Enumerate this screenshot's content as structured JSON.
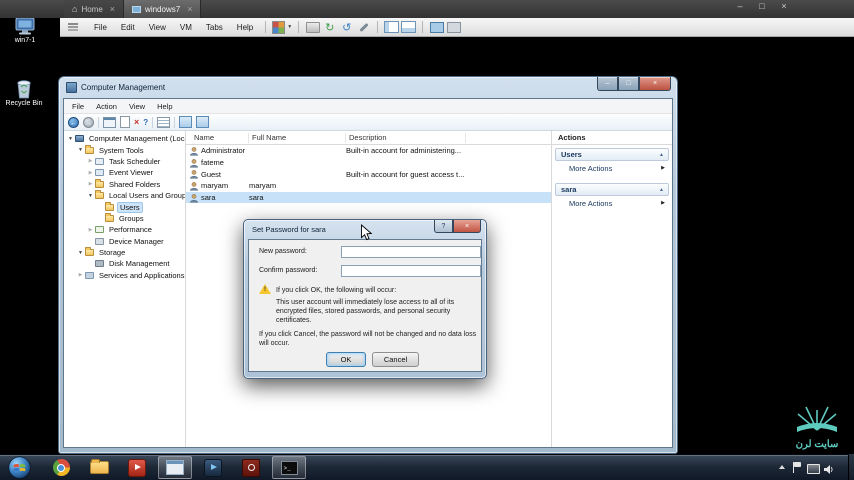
{
  "glyphs": {
    "home": "⌂",
    "tab_close": "×",
    "minimize": "–",
    "maximize": "□",
    "close": "×",
    "dropdown": "▼",
    "expanded": "▼",
    "collapsed": "▶",
    "back_arrow": "←",
    "forward_arrow": "→",
    "delete_x": "×",
    "help": "?",
    "up_chevron": "▲",
    "more_arrow": "▶",
    "snapshot_revert": "↺",
    "snapshot_take": "↻",
    "cmd_prompt": ">_",
    "warning_exclamation": "!"
  },
  "host": {
    "tabs": [
      {
        "label": "Home"
      },
      {
        "label": "windows7"
      }
    ],
    "menu": [
      "File",
      "Edit",
      "View",
      "VM",
      "Tabs",
      "Help"
    ]
  },
  "desktop": {
    "icons": [
      {
        "label": "win7-1"
      },
      {
        "label": "Recycle Bin"
      }
    ],
    "watermark": "سایت لرن"
  },
  "cm": {
    "title": "Computer Management",
    "menu": [
      "File",
      "Action",
      "View",
      "Help"
    ],
    "columns": [
      "Name",
      "Full Name",
      "Description"
    ],
    "tree": [
      {
        "label": "Computer Management (Local"
      },
      {
        "label": "System Tools"
      },
      {
        "label": "Task Scheduler"
      },
      {
        "label": "Event Viewer"
      },
      {
        "label": "Shared Folders"
      },
      {
        "label": "Local Users and Groups"
      },
      {
        "label": "Users"
      },
      {
        "label": "Groups"
      },
      {
        "label": "Performance"
      },
      {
        "label": "Device Manager"
      },
      {
        "label": "Storage"
      },
      {
        "label": "Disk Management"
      },
      {
        "label": "Services and Applications"
      }
    ],
    "users": [
      {
        "name": "Administrator",
        "full_name": "",
        "description": "Built-in account for administering..."
      },
      {
        "name": "fateme",
        "full_name": "",
        "description": ""
      },
      {
        "name": "Guest",
        "full_name": "",
        "description": "Built-in account for guest access t..."
      },
      {
        "name": "maryam",
        "full_name": "maryam",
        "description": ""
      },
      {
        "name": "sara",
        "full_name": "sara",
        "description": ""
      }
    ],
    "actions": {
      "title": "Actions",
      "sections": [
        {
          "header": "Users",
          "more": "More Actions"
        },
        {
          "header": "sara",
          "more": "More Actions"
        }
      ]
    }
  },
  "dialog": {
    "title": "Set Password for sara",
    "new_password_label": "New password:",
    "new_password_value": "",
    "confirm_password_label": "Confirm password:",
    "confirm_password_value": "",
    "warning_intro": "If you click OK, the following will occur:",
    "warning_body": "This user account will immediately lose access to all of its encrypted files, stored passwords, and personal security certificates.",
    "cancel_note": "If you click Cancel, the password will not be changed and no data loss will occur.",
    "ok_label": "OK",
    "cancel_label": "Cancel"
  },
  "colors": {
    "selection_blue": "#c7e2f8",
    "watermark_teal": "#5ecbbf",
    "taskbar_dark": "#16202e"
  }
}
